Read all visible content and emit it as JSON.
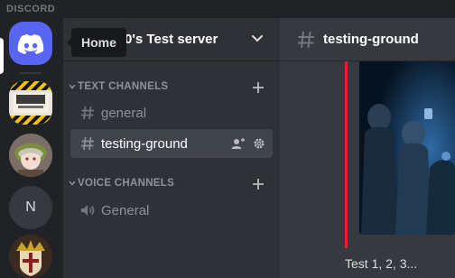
{
  "app": {
    "brand": "DISCORD"
  },
  "tooltip": {
    "label": "Home"
  },
  "servers": [
    {
      "name": "home",
      "icon": "discord-logo-icon"
    },
    {
      "name": "work-in-progress",
      "image_text": "WORK IN PROGRESS"
    },
    {
      "name": "avatar-server"
    },
    {
      "name": "n-server",
      "initial": "N"
    },
    {
      "name": "crest-server"
    }
  ],
  "guild": {
    "name": "0's Test server"
  },
  "categories": {
    "text": "TEXT CHANNELS",
    "voice": "VOICE CHANNELS"
  },
  "channels": {
    "general": "general",
    "testing": "testing-ground",
    "voice_general": "General"
  },
  "main": {
    "title": "testing-ground",
    "message": "Test 1, 2, 3..."
  },
  "colors": {
    "blurple": "#5865f2",
    "embed_bar": "#ed2125",
    "selected_bg": "#40444b"
  }
}
